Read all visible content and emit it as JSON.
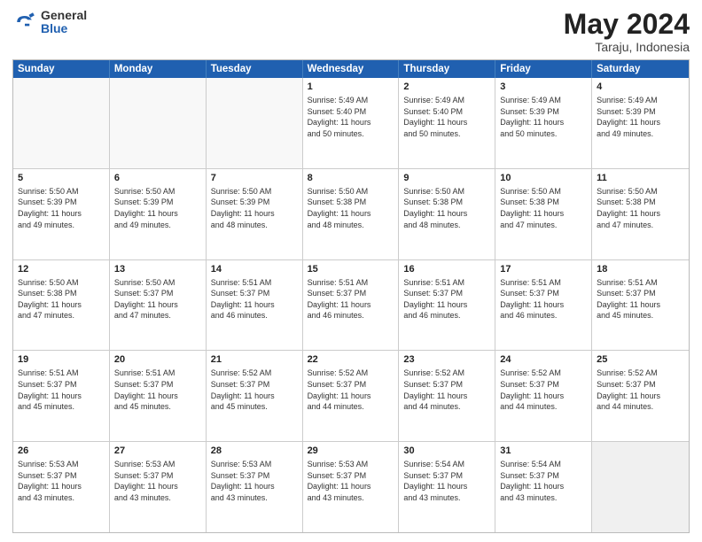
{
  "logo": {
    "general": "General",
    "blue": "Blue"
  },
  "title": {
    "month_year": "May 2024",
    "location": "Taraju, Indonesia"
  },
  "header_days": [
    "Sunday",
    "Monday",
    "Tuesday",
    "Wednesday",
    "Thursday",
    "Friday",
    "Saturday"
  ],
  "rows": [
    [
      {
        "day": "",
        "text": "",
        "empty": true
      },
      {
        "day": "",
        "text": "",
        "empty": true
      },
      {
        "day": "",
        "text": "",
        "empty": true
      },
      {
        "day": "1",
        "text": "Sunrise: 5:49 AM\nSunset: 5:40 PM\nDaylight: 11 hours\nand 50 minutes."
      },
      {
        "day": "2",
        "text": "Sunrise: 5:49 AM\nSunset: 5:40 PM\nDaylight: 11 hours\nand 50 minutes."
      },
      {
        "day": "3",
        "text": "Sunrise: 5:49 AM\nSunset: 5:39 PM\nDaylight: 11 hours\nand 50 minutes."
      },
      {
        "day": "4",
        "text": "Sunrise: 5:49 AM\nSunset: 5:39 PM\nDaylight: 11 hours\nand 49 minutes."
      }
    ],
    [
      {
        "day": "5",
        "text": "Sunrise: 5:50 AM\nSunset: 5:39 PM\nDaylight: 11 hours\nand 49 minutes."
      },
      {
        "day": "6",
        "text": "Sunrise: 5:50 AM\nSunset: 5:39 PM\nDaylight: 11 hours\nand 49 minutes."
      },
      {
        "day": "7",
        "text": "Sunrise: 5:50 AM\nSunset: 5:39 PM\nDaylight: 11 hours\nand 48 minutes."
      },
      {
        "day": "8",
        "text": "Sunrise: 5:50 AM\nSunset: 5:38 PM\nDaylight: 11 hours\nand 48 minutes."
      },
      {
        "day": "9",
        "text": "Sunrise: 5:50 AM\nSunset: 5:38 PM\nDaylight: 11 hours\nand 48 minutes."
      },
      {
        "day": "10",
        "text": "Sunrise: 5:50 AM\nSunset: 5:38 PM\nDaylight: 11 hours\nand 47 minutes."
      },
      {
        "day": "11",
        "text": "Sunrise: 5:50 AM\nSunset: 5:38 PM\nDaylight: 11 hours\nand 47 minutes."
      }
    ],
    [
      {
        "day": "12",
        "text": "Sunrise: 5:50 AM\nSunset: 5:38 PM\nDaylight: 11 hours\nand 47 minutes."
      },
      {
        "day": "13",
        "text": "Sunrise: 5:50 AM\nSunset: 5:37 PM\nDaylight: 11 hours\nand 47 minutes."
      },
      {
        "day": "14",
        "text": "Sunrise: 5:51 AM\nSunset: 5:37 PM\nDaylight: 11 hours\nand 46 minutes."
      },
      {
        "day": "15",
        "text": "Sunrise: 5:51 AM\nSunset: 5:37 PM\nDaylight: 11 hours\nand 46 minutes."
      },
      {
        "day": "16",
        "text": "Sunrise: 5:51 AM\nSunset: 5:37 PM\nDaylight: 11 hours\nand 46 minutes."
      },
      {
        "day": "17",
        "text": "Sunrise: 5:51 AM\nSunset: 5:37 PM\nDaylight: 11 hours\nand 46 minutes."
      },
      {
        "day": "18",
        "text": "Sunrise: 5:51 AM\nSunset: 5:37 PM\nDaylight: 11 hours\nand 45 minutes."
      }
    ],
    [
      {
        "day": "19",
        "text": "Sunrise: 5:51 AM\nSunset: 5:37 PM\nDaylight: 11 hours\nand 45 minutes."
      },
      {
        "day": "20",
        "text": "Sunrise: 5:51 AM\nSunset: 5:37 PM\nDaylight: 11 hours\nand 45 minutes."
      },
      {
        "day": "21",
        "text": "Sunrise: 5:52 AM\nSunset: 5:37 PM\nDaylight: 11 hours\nand 45 minutes."
      },
      {
        "day": "22",
        "text": "Sunrise: 5:52 AM\nSunset: 5:37 PM\nDaylight: 11 hours\nand 44 minutes."
      },
      {
        "day": "23",
        "text": "Sunrise: 5:52 AM\nSunset: 5:37 PM\nDaylight: 11 hours\nand 44 minutes."
      },
      {
        "day": "24",
        "text": "Sunrise: 5:52 AM\nSunset: 5:37 PM\nDaylight: 11 hours\nand 44 minutes."
      },
      {
        "day": "25",
        "text": "Sunrise: 5:52 AM\nSunset: 5:37 PM\nDaylight: 11 hours\nand 44 minutes."
      }
    ],
    [
      {
        "day": "26",
        "text": "Sunrise: 5:53 AM\nSunset: 5:37 PM\nDaylight: 11 hours\nand 43 minutes."
      },
      {
        "day": "27",
        "text": "Sunrise: 5:53 AM\nSunset: 5:37 PM\nDaylight: 11 hours\nand 43 minutes."
      },
      {
        "day": "28",
        "text": "Sunrise: 5:53 AM\nSunset: 5:37 PM\nDaylight: 11 hours\nand 43 minutes."
      },
      {
        "day": "29",
        "text": "Sunrise: 5:53 AM\nSunset: 5:37 PM\nDaylight: 11 hours\nand 43 minutes."
      },
      {
        "day": "30",
        "text": "Sunrise: 5:54 AM\nSunset: 5:37 PM\nDaylight: 11 hours\nand 43 minutes."
      },
      {
        "day": "31",
        "text": "Sunrise: 5:54 AM\nSunset: 5:37 PM\nDaylight: 11 hours\nand 43 minutes."
      },
      {
        "day": "",
        "text": "",
        "empty": true,
        "shaded": true
      }
    ]
  ]
}
